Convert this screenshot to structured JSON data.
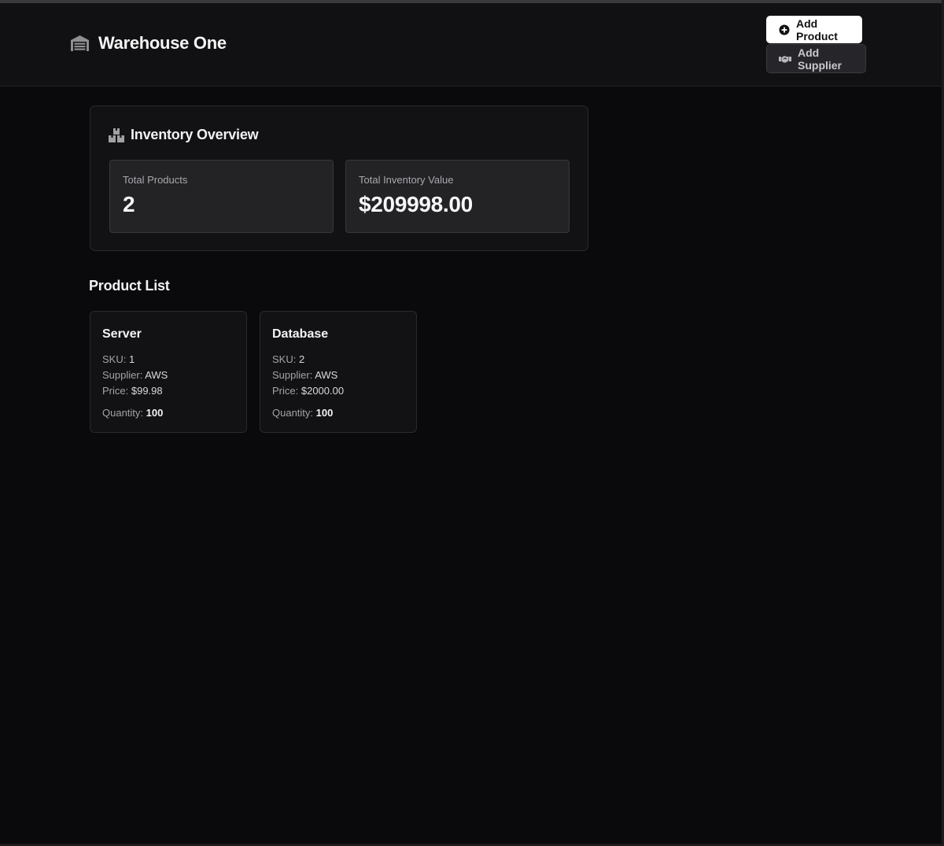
{
  "header": {
    "title": "Warehouse One",
    "icon": "warehouse-icon",
    "buttons": {
      "add_product": {
        "label": "Add Product",
        "icon": "plus-circle-icon"
      },
      "add_supplier": {
        "label": "Add Supplier",
        "icon": "handshake-icon"
      }
    }
  },
  "overview": {
    "title": "Inventory Overview",
    "icon": "boxes-icon",
    "stats": [
      {
        "label": "Total Products",
        "value": "2"
      },
      {
        "label": "Total Inventory Value",
        "value": "$209998.00"
      }
    ]
  },
  "product_list": {
    "title": "Product List",
    "labels": {
      "sku": "SKU:",
      "supplier": "Supplier:",
      "price": "Price:",
      "quantity": "Quantity:"
    },
    "items": [
      {
        "name": "Server",
        "sku": "1",
        "supplier": "AWS",
        "price": "$99.98",
        "quantity": "100"
      },
      {
        "name": "Database",
        "sku": "2",
        "supplier": "AWS",
        "price": "$2000.00",
        "quantity": "100"
      }
    ]
  },
  "colors": {
    "background": "#0a0a0c",
    "header_bg": "#111113",
    "card_bg": "#121214",
    "stat_bg": "#232326",
    "primary_button_bg": "#ffffff"
  }
}
